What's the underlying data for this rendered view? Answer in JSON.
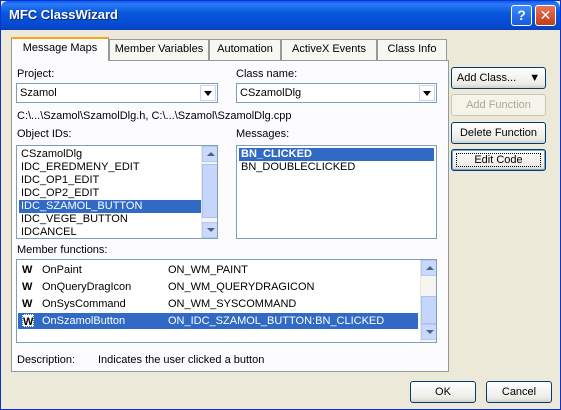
{
  "window": {
    "title": "MFC ClassWizard",
    "help_label": "?",
    "close_label": "✕"
  },
  "tabs": [
    {
      "label": "Message Maps",
      "active": true
    },
    {
      "label": "Member Variables"
    },
    {
      "label": "Automation"
    },
    {
      "label": "ActiveX Events"
    },
    {
      "label": "Class Info"
    }
  ],
  "project": {
    "label": "Project:",
    "value": "Szamol"
  },
  "class_name": {
    "label": "Class name:",
    "value": "CSzamolDlg"
  },
  "file_paths": "C:\\...\\Szamol\\SzamolDlg.h, C:\\...\\Szamol\\SzamolDlg.cpp",
  "object_ids": {
    "label": "Object IDs:",
    "items": [
      "CSzamolDlg",
      "IDC_EREDMENY_EDIT",
      "IDC_OP1_EDIT",
      "IDC_OP2_EDIT",
      "IDC_SZAMOL_BUTTON",
      "IDC_VEGE_BUTTON",
      "IDCANCEL"
    ],
    "selected": "IDC_SZAMOL_BUTTON"
  },
  "messages": {
    "label": "Messages:",
    "items": [
      "BN_CLICKED",
      "BN_DOUBLECLICKED"
    ],
    "selected": "BN_CLICKED"
  },
  "member_functions": {
    "label": "Member functions:",
    "rows": [
      {
        "icon": "W",
        "name": "OnPaint",
        "map": "ON_WM_PAINT"
      },
      {
        "icon": "W",
        "name": "OnQueryDragIcon",
        "map": "ON_WM_QUERYDRAGICON"
      },
      {
        "icon": "W",
        "name": "OnSysCommand",
        "map": "ON_WM_SYSCOMMAND"
      },
      {
        "icon": "W",
        "name": "OnSzamolButton",
        "map": "ON_IDC_SZAMOL_BUTTON:BN_CLICKED"
      }
    ],
    "selected": "OnSzamolButton"
  },
  "description": {
    "label": "Description:",
    "text": "Indicates the user clicked a button"
  },
  "buttons": {
    "add_class": "Add Class...",
    "add_function": "Add Function",
    "delete_function": "Delete Function",
    "edit_code": "Edit Code",
    "ok": "OK",
    "cancel": "Cancel"
  }
}
